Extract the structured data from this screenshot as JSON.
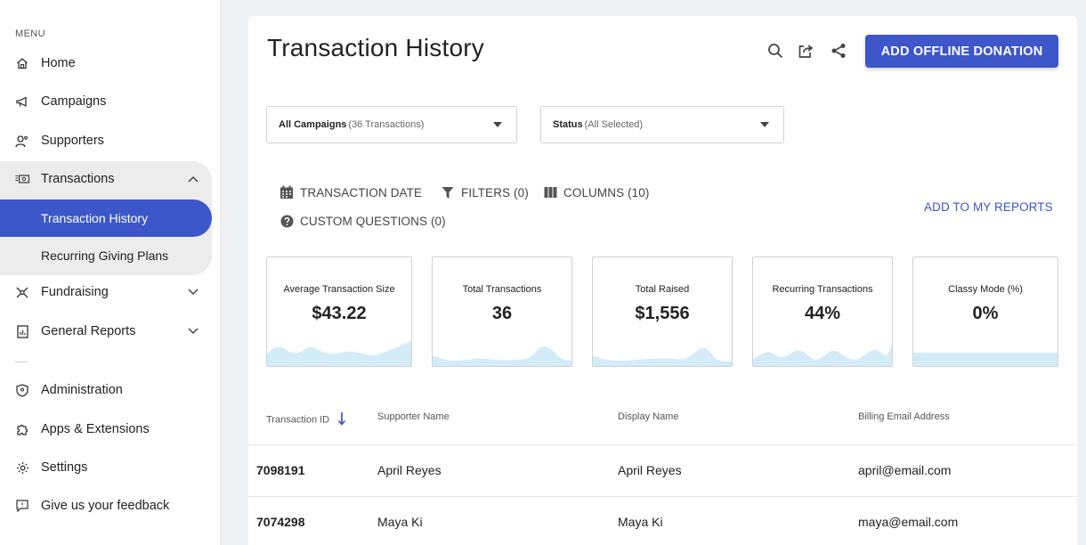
{
  "sidebar": {
    "menu_label": "MENU",
    "items": [
      {
        "label": "Home",
        "icon": "home-icon"
      },
      {
        "label": "Campaigns",
        "icon": "megaphone-icon"
      },
      {
        "label": "Supporters",
        "icon": "supporters-icon"
      },
      {
        "label": "Transactions",
        "icon": "transactions-icon",
        "expanded": true
      },
      {
        "label": "Fundraising",
        "icon": "fundraising-icon"
      },
      {
        "label": "General Reports",
        "icon": "report-icon"
      },
      {
        "label": "Administration",
        "icon": "shield-icon"
      },
      {
        "label": "Apps & Extensions",
        "icon": "puzzle-icon"
      },
      {
        "label": "Settings",
        "icon": "gear-icon"
      },
      {
        "label": "Give us your feedback",
        "icon": "feedback-icon"
      }
    ],
    "sub_items": [
      {
        "label": "Transaction History",
        "active": true
      },
      {
        "label": "Recurring Giving Plans",
        "active": false
      }
    ]
  },
  "header": {
    "title": "Transaction History",
    "primary_button": "ADD OFFLINE DONATION"
  },
  "filters": {
    "campaigns": {
      "label": "All Campaigns",
      "detail": "(36 Transactions)"
    },
    "status": {
      "label": "Status",
      "detail": "(All Selected)"
    }
  },
  "toolbar": {
    "date": "TRANSACTION DATE",
    "filters": "FILTERS (0)",
    "columns": "COLUMNS (10)",
    "custom_questions": "CUSTOM QUESTIONS (0)",
    "reports": "ADD TO MY REPORTS"
  },
  "stats": [
    {
      "label": "Average Transaction Size",
      "value": "$43.22"
    },
    {
      "label": "Total Transactions",
      "value": "36"
    },
    {
      "label": "Total Raised",
      "value": "$1,556"
    },
    {
      "label": "Recurring Transactions",
      "value": "44%"
    },
    {
      "label": "Classy Mode (%)",
      "value": "0%"
    }
  ],
  "table": {
    "columns": [
      "Transaction ID",
      "Supporter Name",
      "Display Name",
      "Billing Email Address"
    ],
    "rows": [
      [
        "7098191",
        "April Reyes",
        "April Reyes",
        "april@email.com"
      ],
      [
        "7074298",
        "Maya Ki",
        "Maya Ki",
        "maya@email.com"
      ]
    ]
  },
  "colors": {
    "accent": "#3d56c9",
    "sparkline": "#d4ebf8"
  }
}
